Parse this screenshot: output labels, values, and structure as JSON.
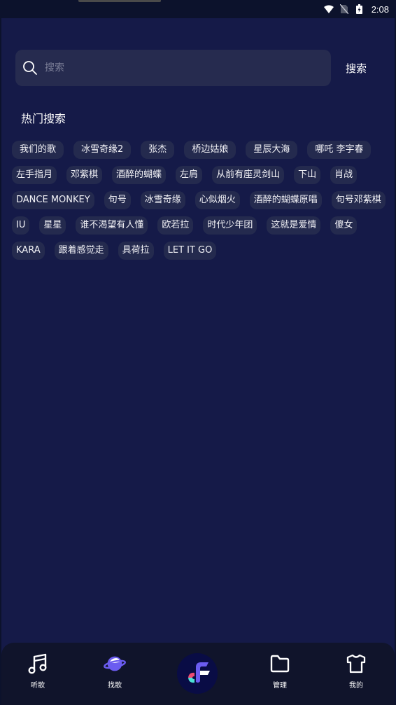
{
  "status_bar": {
    "time": "2:08",
    "icons": [
      "wifi-icon",
      "no-sim-icon",
      "battery-charging-icon"
    ]
  },
  "search": {
    "placeholder": "搜索",
    "value": "",
    "button_label": "搜索",
    "icon": "search-icon"
  },
  "hot_search": {
    "title": "热门搜索",
    "tags": [
      "我们的歌",
      "冰雪奇缘2",
      "张杰",
      "桥边姑娘",
      "星辰大海",
      "哪吒 李宇春",
      "左手指月",
      "邓紫棋",
      "酒醉的蝴蝶",
      "左肩",
      "从前有座灵剑山",
      "下山",
      "肖战",
      "DANCE MONKEY",
      "句号",
      "冰雪奇缘",
      "心似烟火",
      "酒醉的蝴蝶原唱",
      "句号邓紫棋",
      "IU",
      "星星",
      "谁不渴望有人懂",
      "欧若拉",
      "时代少年团",
      "这就是爱情",
      "傻女",
      "KARA",
      "跟着感觉走",
      "具荷拉",
      "LET IT GO"
    ]
  },
  "tabbar": {
    "items": [
      {
        "label": "听歌",
        "icon": "music-note-icon"
      },
      {
        "label": "找歌",
        "icon": "planet-icon"
      },
      {
        "label": "",
        "icon": "app-logo-icon"
      },
      {
        "label": "管理",
        "icon": "folder-icon"
      },
      {
        "label": "我的",
        "icon": "tshirt-icon"
      }
    ]
  },
  "colors": {
    "background": "#151a48",
    "status_bar": "#0c122c",
    "search_box": "#262b4f",
    "tag_bg": "#242a4e",
    "tabbar_bg": "#10142b",
    "accent_purple": "#6b5cf0",
    "accent_pink": "#ee4a72",
    "accent_cyan": "#4de0d6"
  }
}
